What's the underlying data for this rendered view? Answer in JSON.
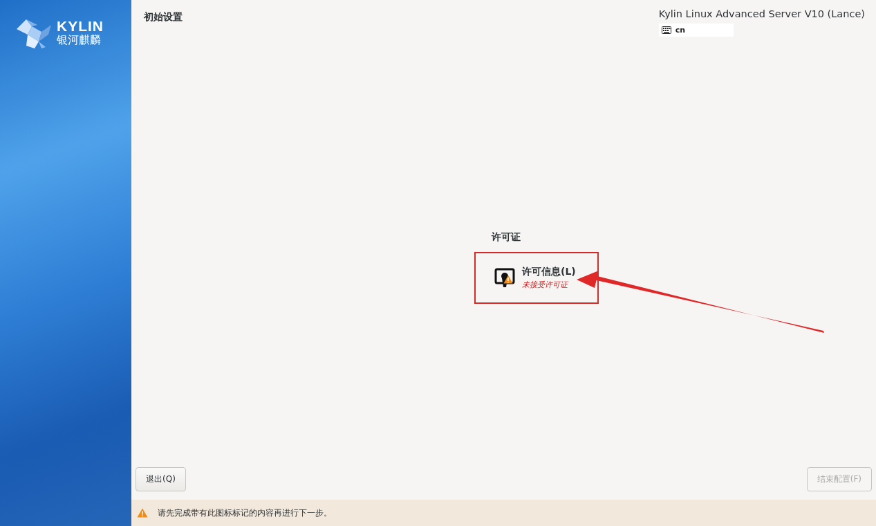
{
  "sidebar": {
    "logo": {
      "brand": "KYLIN",
      "brand_cn": "银河麒麟"
    }
  },
  "header": {
    "title": "初始设置",
    "product": "Kylin Linux Advanced Server V10 (Lance)",
    "keyboard_layout": "cn"
  },
  "sections": [
    {
      "title": "许可证",
      "spokes": [
        {
          "title": "许可信息(L)",
          "status": "未接受许可证",
          "warning": true,
          "highlighted": true
        }
      ]
    }
  ],
  "buttons": [
    {
      "label": "退出(Q)",
      "disabled": false
    },
    {
      "label": "结束配置(F)",
      "disabled": true
    }
  ],
  "warning_bar": {
    "message": "请先完成带有此图标标记的内容再进行下一步。"
  }
}
